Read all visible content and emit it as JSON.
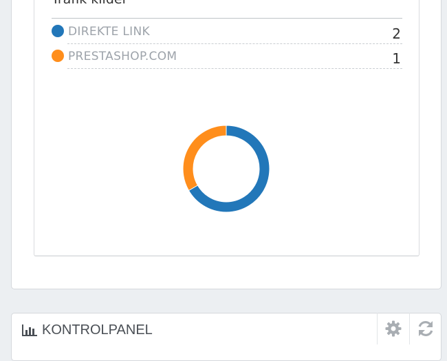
{
  "traffic": {
    "title": "Trafik kilder",
    "sources": [
      {
        "label": "DIREKTE LINK",
        "count": "2",
        "color": "#2277b9"
      },
      {
        "label": "PRESTASHOP.COM",
        "count": "1",
        "color": "#ff8e1c"
      }
    ]
  },
  "chart_data": {
    "type": "pie",
    "categories": [
      "DIREKTE LINK",
      "PRESTASHOP.COM"
    ],
    "values": [
      2,
      1
    ],
    "colors": [
      "#2277b9",
      "#ff8e1c"
    ],
    "donut": true
  },
  "dashboard": {
    "title": "KONTROLPANEL",
    "icons": {
      "title": "bar-chart-icon",
      "configure": "gear-icon",
      "refresh": "refresh-icon"
    }
  }
}
